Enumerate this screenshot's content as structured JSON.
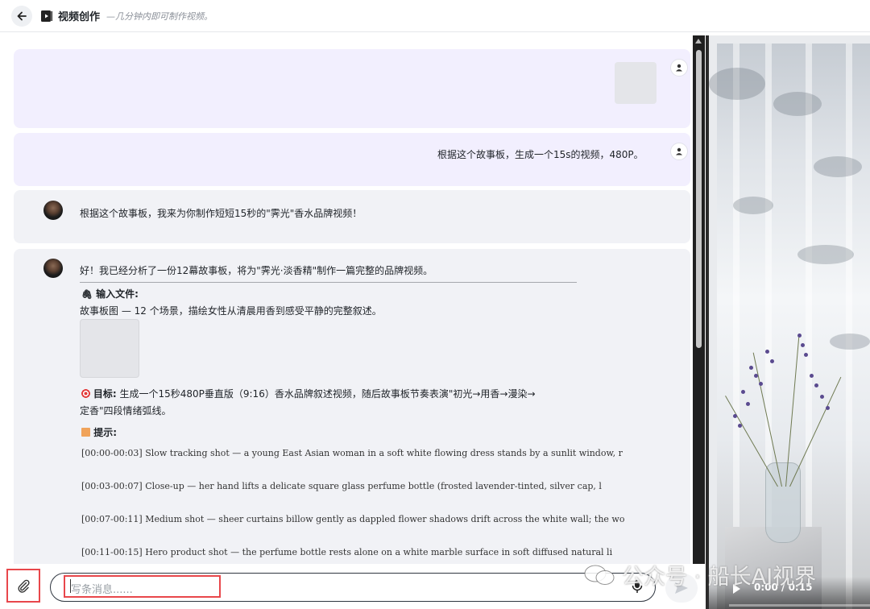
{
  "header": {
    "title": "视频创作",
    "subtitle": "—几分钟内即可制作视频。"
  },
  "messages": {
    "user_text": "根据这个故事板，生成一个15s的视频，480P。",
    "bot_intro": "根据这个故事板，我来为你制作短短15秒的\"霁光\"香水品牌视频！",
    "bot_analysis": "好！我已经分析了一份12幕故事板，将为\"霁光·淡香精\"制作一篇完整的品牌视频。",
    "input_heading": "输入文件:",
    "input_desc": "故事板图 — 12 个场景，描绘女性从清晨用香到感受平静的完整叙述。",
    "goal_heading": "目标:",
    "goal_line1": "生成一个15秒480P垂直版（9:16）香水品牌叙述视频，随后故事板节奏表演\"初光→用香→漫染→",
    "goal_line2": "定香\"四段情绪弧线。",
    "prompt_heading": "提示:",
    "prompts": [
      "[00:00-00:03] Slow tracking shot — a young East Asian woman in a soft white flowing dress stands by a sunlit window, r",
      "[00:03-00:07] Close-up — her hand lifts a delicate square glass perfume bottle (frosted lavender-tinted, silver cap, l",
      "[00:07-00:11] Medium shot — sheer curtains billow gently as dappled flower shadows drift across the white wall; the wo",
      "[00:11-00:15] Hero product shot — the perfume bottle rests alone on a white marble surface in soft diffused natural li"
    ]
  },
  "composer": {
    "placeholder": "写条消息......"
  },
  "video": {
    "time": "0:00 / 0:15",
    "progress": 0
  },
  "watermark": {
    "text": "公众号 · 船长AI视界"
  },
  "icons": {
    "back": "arrow-left-icon",
    "app": "video-play-icon",
    "user": "user-icon",
    "attach": "paperclip-icon",
    "mic": "mic-icon",
    "send": "send-icon",
    "file": "paperclip-emoji-icon",
    "goal": "target-emoji-icon",
    "prompt": "memo-emoji-icon"
  },
  "colors": {
    "user_bubble": "#f2effe",
    "bot_bubble": "#f1f2f6",
    "highlight": "#e8474b"
  }
}
